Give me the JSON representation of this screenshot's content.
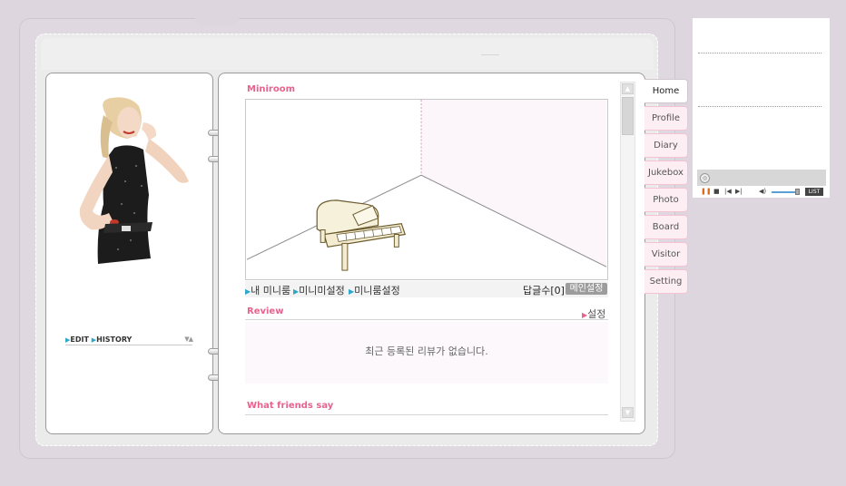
{
  "tabs": [
    {
      "label": "Home",
      "active": true
    },
    {
      "label": "Profile"
    },
    {
      "label": "Diary"
    },
    {
      "label": "Jukebox"
    },
    {
      "label": "Photo"
    },
    {
      "label": "Board"
    },
    {
      "label": "Visitor"
    },
    {
      "label": "Setting"
    }
  ],
  "left_page": {
    "edit_label": "EDIT",
    "history_label": "HISTORY"
  },
  "miniroom": {
    "title": "Miniroom",
    "links": [
      "내 미니룸",
      "미니미설정",
      "미니룸설정"
    ],
    "reply_count_label": "답글수[0]",
    "main_setting_label": "메인설정"
  },
  "review": {
    "title": "Review",
    "setting_label": "설정",
    "empty_message": "최근 등록된 리뷰가 없습니다."
  },
  "friends": {
    "title": "What friends say"
  },
  "player": {
    "list_label": "LIST"
  },
  "colors": {
    "accent_pink": "#e8628d",
    "link_blue": "#2aa7c9",
    "background": "#ddd6df"
  }
}
